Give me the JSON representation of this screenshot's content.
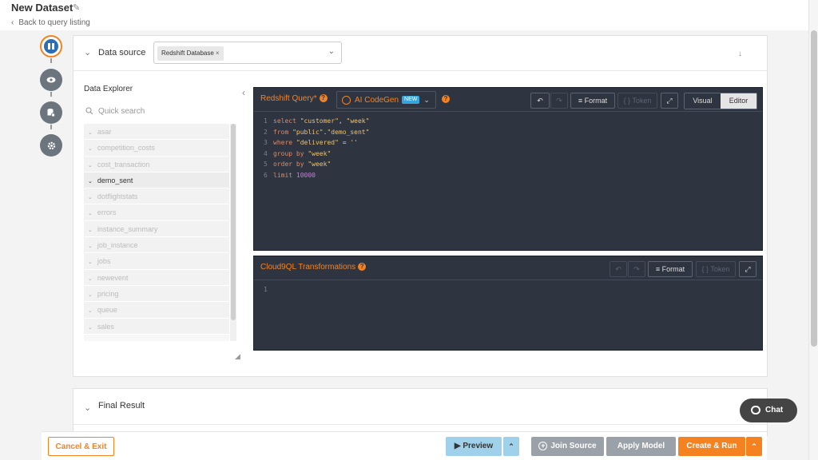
{
  "header": {
    "title": "New Dataset",
    "back_link": "Back to query listing"
  },
  "data_source": {
    "label": "Data source",
    "selected_tag": "Redshift Database",
    "tag_remove": "×"
  },
  "explorer": {
    "title": "Data Explorer",
    "search_placeholder": "Quick search",
    "tables": [
      "asar",
      "competition_costs",
      "cost_transaction",
      "demo_sent",
      "dotflightstats",
      "errors",
      "instance_summary",
      "job_instance",
      "jobs",
      "newevent",
      "pricing",
      "queue",
      "sales"
    ],
    "selected_table": "demo_sent"
  },
  "query_editor": {
    "title": "Redshift Query*",
    "codegen_label": "AI CodeGen",
    "codegen_badge": "NEW",
    "format_label": "Format",
    "token_label": "Token",
    "mode_visual": "Visual",
    "mode_editor": "Editor",
    "active_mode": "Editor",
    "lines": [
      {
        "n": "1",
        "parts": [
          [
            "kw",
            "select "
          ],
          [
            "str",
            "\"customer\""
          ],
          [
            "op",
            ", "
          ],
          [
            "str",
            "\"week\""
          ]
        ]
      },
      {
        "n": "2",
        "parts": [
          [
            "kw",
            "from "
          ],
          [
            "str",
            "\"public\""
          ],
          [
            "op",
            "."
          ],
          [
            "str",
            "\"demo_sent\""
          ]
        ]
      },
      {
        "n": "3",
        "parts": [
          [
            "kw",
            "where "
          ],
          [
            "str",
            "\"delivered\""
          ],
          [
            "op",
            " = "
          ],
          [
            "str",
            "''"
          ]
        ]
      },
      {
        "n": "4",
        "parts": [
          [
            "kw",
            "group by "
          ],
          [
            "str",
            "\"week\""
          ]
        ]
      },
      {
        "n": "5",
        "parts": [
          [
            "kw",
            "order by "
          ],
          [
            "str",
            "\"week\""
          ]
        ]
      },
      {
        "n": "6",
        "parts": [
          [
            "kw",
            "limit "
          ],
          [
            "num",
            "10000"
          ]
        ]
      }
    ]
  },
  "transform_editor": {
    "title": "Cloud9QL Transformations",
    "format_label": "Format",
    "token_label": "Token",
    "line_number": "1"
  },
  "final_result": {
    "label": "Final Result"
  },
  "chat": {
    "label": "Chat"
  },
  "footer": {
    "cancel": "Cancel & Exit",
    "preview": "Preview",
    "join_source": "Join Source",
    "apply_model": "Apply Model",
    "create_run": "Create & Run"
  },
  "colors": {
    "accent": "#f58220",
    "editor_bg": "#2e3541",
    "preview_bg": "#9fd1ea",
    "secondary_btn": "#9aa1a9"
  }
}
